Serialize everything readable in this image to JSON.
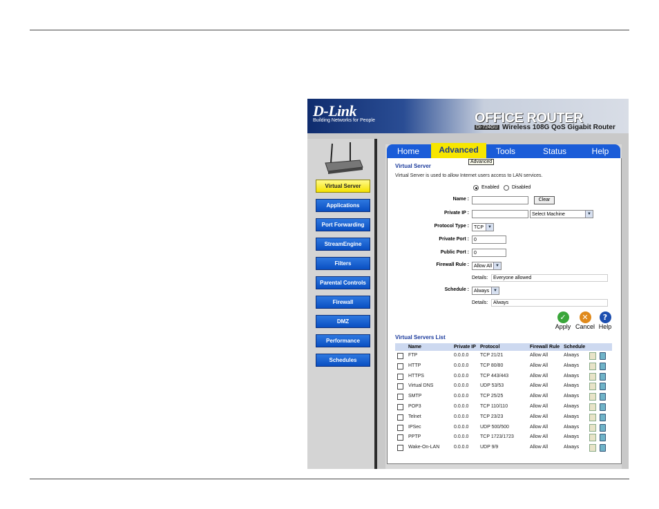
{
  "banner": {
    "logo": "D-Link",
    "tagline": "Building Networks for People",
    "product": "OFFICE ROUTER",
    "model": "DI-724GU",
    "subtitle": "Wireless 108G QoS Gigabit Router"
  },
  "sidebar": {
    "items": [
      {
        "label": "Virtual Server",
        "active": true
      },
      {
        "label": "Applications"
      },
      {
        "label": "Port Forwarding"
      },
      {
        "label": "StreamEngine"
      },
      {
        "label": "Filters"
      },
      {
        "label": "Parental Controls"
      },
      {
        "label": "Firewall"
      },
      {
        "label": "DMZ"
      },
      {
        "label": "Performance"
      },
      {
        "label": "Schedules"
      }
    ]
  },
  "tabs": [
    "Home",
    "Advanced",
    "Tools",
    "Status",
    "Help"
  ],
  "tooltip": "Advanced",
  "section": {
    "title": "Virtual Server",
    "description": "Virtual Server is used to allow Internet users access to LAN services."
  },
  "form": {
    "enabled_label": "Enabled",
    "disabled_label": "Disabled",
    "name_label": "Name :",
    "name_value": "",
    "clear_label": "Clear",
    "private_ip_label": "Private IP :",
    "private_ip_value": "",
    "select_machine": "Select Machine",
    "protocol_label": "Protocol Type :",
    "protocol_value": "TCP",
    "private_port_label": "Private Port :",
    "private_port_value": "0",
    "public_port_label": "Public Port :",
    "public_port_value": "0",
    "firewall_label": "Firewall Rule :",
    "firewall_value": "Allow All",
    "details_label": "Details:",
    "firewall_details": "Everyone allowed",
    "schedule_label": "Schedule :",
    "schedule_value": "Always",
    "schedule_details": "Always"
  },
  "actions": {
    "apply": "Apply",
    "cancel": "Cancel",
    "help": "Help"
  },
  "list": {
    "title": "Virtual Servers List",
    "headers": [
      "Name",
      "Private IP",
      "Protocol",
      "Firewall Rule",
      "Schedule"
    ],
    "rows": [
      {
        "name": "FTP",
        "ip": "0.0.0.0",
        "protocol": "TCP 21/21",
        "rule": "Allow All",
        "schedule": "Always"
      },
      {
        "name": "HTTP",
        "ip": "0.0.0.0",
        "protocol": "TCP 80/80",
        "rule": "Allow All",
        "schedule": "Always"
      },
      {
        "name": "HTTPS",
        "ip": "0.0.0.0",
        "protocol": "TCP 443/443",
        "rule": "Allow All",
        "schedule": "Always"
      },
      {
        "name": "Virtual DNS",
        "ip": "0.0.0.0",
        "protocol": "UDP 53/53",
        "rule": "Allow All",
        "schedule": "Always"
      },
      {
        "name": "SMTP",
        "ip": "0.0.0.0",
        "protocol": "TCP 25/25",
        "rule": "Allow All",
        "schedule": "Always"
      },
      {
        "name": "POP3",
        "ip": "0.0.0.0",
        "protocol": "TCP 110/110",
        "rule": "Allow All",
        "schedule": "Always"
      },
      {
        "name": "Telnet",
        "ip": "0.0.0.0",
        "protocol": "TCP 23/23",
        "rule": "Allow All",
        "schedule": "Always"
      },
      {
        "name": "IPSec",
        "ip": "0.0.0.0",
        "protocol": "UDP 500/500",
        "rule": "Allow All",
        "schedule": "Always"
      },
      {
        "name": "PPTP",
        "ip": "0.0.0.0",
        "protocol": "TCP 1723/1723",
        "rule": "Allow All",
        "schedule": "Always"
      },
      {
        "name": "Wake-On-LAN",
        "ip": "0.0.0.0",
        "protocol": "UDP 9/9",
        "rule": "Allow All",
        "schedule": "Always"
      }
    ]
  },
  "colors": {
    "accent": "#1a5cd8",
    "active_tab": "#f7e600",
    "section_title": "#1a3a9c"
  }
}
